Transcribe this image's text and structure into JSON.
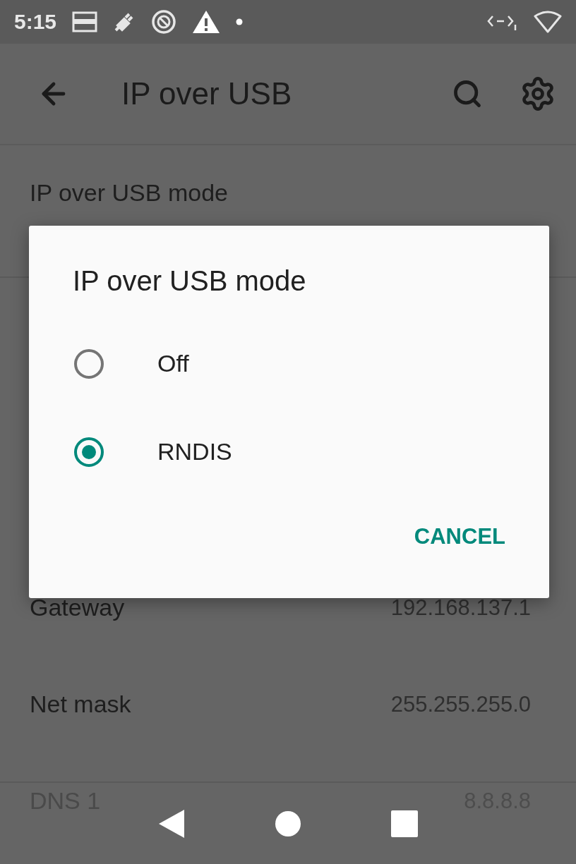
{
  "status_bar": {
    "time": "5:15"
  },
  "app_bar": {
    "title": "IP over USB"
  },
  "settings": [
    {
      "kind": "header",
      "title": "IP over USB mode"
    },
    {
      "kind": "value",
      "title": "Gateway",
      "value": "192.168.137.1"
    },
    {
      "kind": "value",
      "title": "Net mask",
      "value": "255.255.255.0"
    },
    {
      "kind": "value",
      "title": "DNS 1",
      "value": "8.8.8.8"
    }
  ],
  "dialog": {
    "title": "IP over USB mode",
    "options": [
      {
        "label": "Off",
        "selected": false
      },
      {
        "label": "RNDIS",
        "selected": true
      }
    ],
    "buttons": [
      "CANCEL"
    ]
  }
}
